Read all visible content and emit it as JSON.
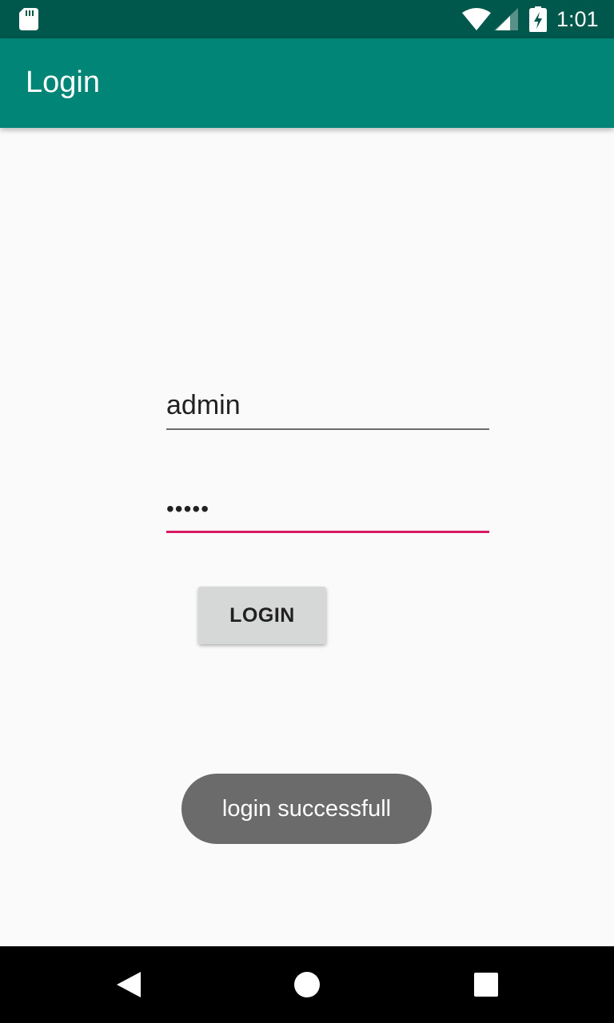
{
  "status_bar": {
    "time": "1:01",
    "icons": [
      "sd-card-icon",
      "wifi-icon",
      "signal-icon",
      "battery-charging-icon"
    ]
  },
  "app_bar": {
    "title": "Login"
  },
  "form": {
    "username_value": "admin",
    "password_value": "•••••",
    "login_label": "LOGIN"
  },
  "toast": {
    "message": "login successfull"
  },
  "nav_bar": {
    "icons": [
      "back-icon",
      "home-icon",
      "recents-icon"
    ]
  },
  "colors": {
    "status_bar": "#00574b",
    "app_bar": "#008577",
    "accent": "#d81b60",
    "background": "#fafafa",
    "button": "#d6d7d7",
    "toast": "#6b6b6b"
  }
}
